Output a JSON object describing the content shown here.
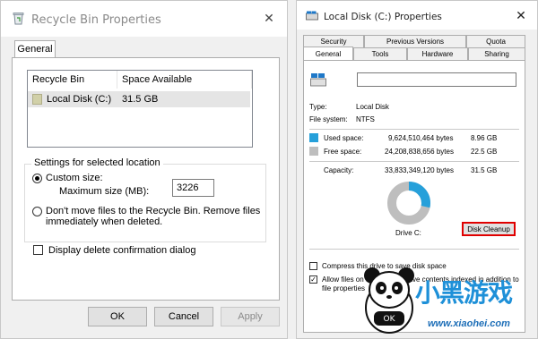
{
  "recycle": {
    "title": "Recycle Bin Properties",
    "close": "✕",
    "tab": "General",
    "columns": [
      "Recycle Bin Location",
      "Space Available"
    ],
    "rows": [
      {
        "location": "Local Disk (C:)",
        "space": "31.5 GB"
      }
    ],
    "settings_label": "Settings for selected location",
    "custom_size_label": "Custom size:",
    "max_size_label": "Maximum size (MB):",
    "max_size_value": "3226",
    "dont_move_label": "Don't move files to the Recycle Bin. Remove files immediately when deleted.",
    "confirm_label": "Display delete confirmation dialog",
    "buttons": {
      "ok": "OK",
      "cancel": "Cancel",
      "apply": "Apply"
    }
  },
  "disk": {
    "title": "Local Disk (C:) Properties",
    "close": "✕",
    "tabs_top": [
      "Security",
      "Previous Versions",
      "Quota"
    ],
    "tabs_bottom": [
      "General",
      "Tools",
      "Hardware",
      "Sharing"
    ],
    "type_label": "Type:",
    "type_value": "Local Disk",
    "fs_label": "File system:",
    "fs_value": "NTFS",
    "used_label": "Used space:",
    "used_bytes": "9,624,510,464 bytes",
    "used_gb": "8.96 GB",
    "free_label": "Free space:",
    "free_bytes": "24,208,838,656 bytes",
    "free_gb": "22.5 GB",
    "capacity_label": "Capacity:",
    "capacity_bytes": "33,833,349,120 bytes",
    "capacity_gb": "31.5 GB",
    "drive_label": "Drive C:",
    "cleanup_button": "Disk Cleanup",
    "compress_label": "Compress this drive to save disk space",
    "index_label_1": "Allow files on this drive to have contents indexed in addition to",
    "index_label_2": "file properties",
    "used_fraction": 0.2845,
    "colors": {
      "used": "#26a0da",
      "free": "#bebebe",
      "highlight": "#e00000"
    }
  },
  "watermark": {
    "logo_text": "小黑游戏",
    "url": "www.xiaohei.com"
  }
}
